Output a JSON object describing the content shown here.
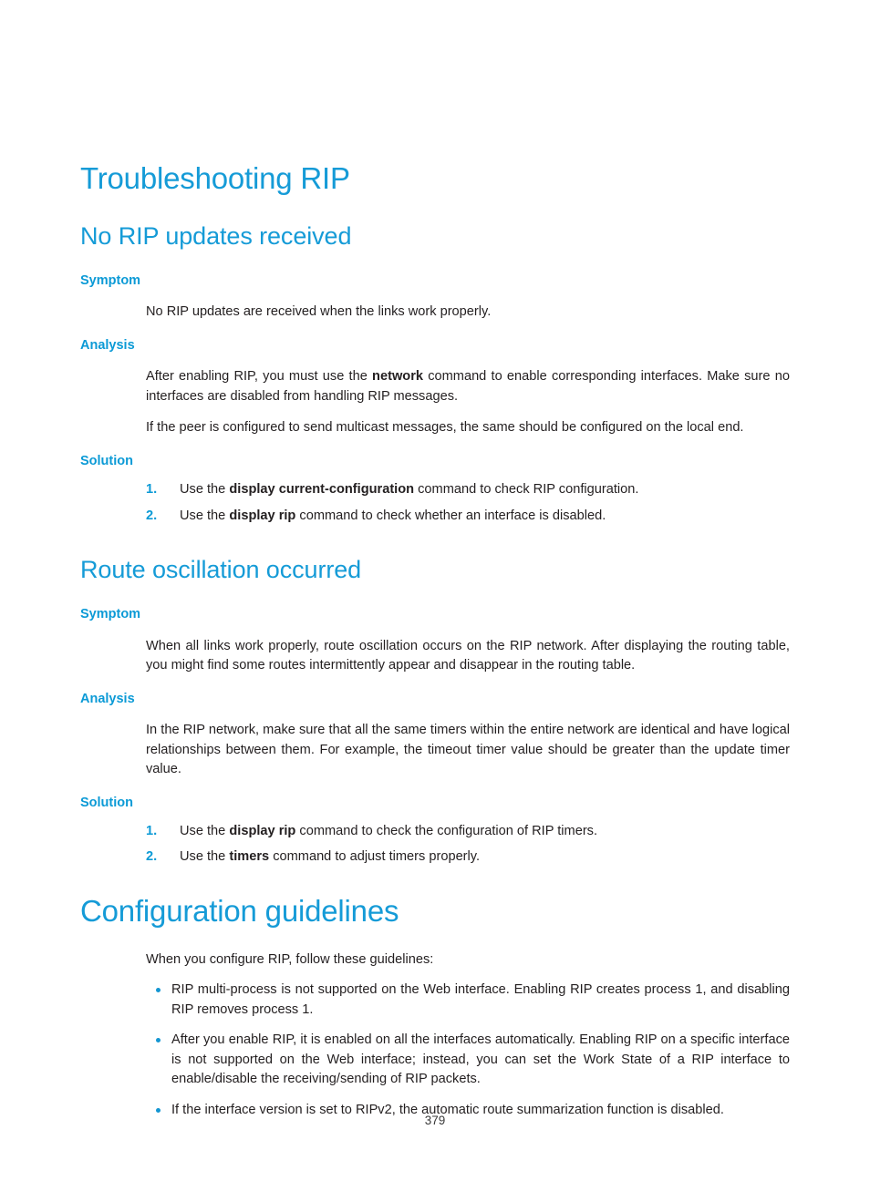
{
  "document": {
    "page_number": "379"
  },
  "colors": {
    "heading": "#159bd7",
    "subheading": "#0b9ad6",
    "list_marker": "#0b9ad6",
    "bullet": "#1496d2",
    "body_text": "#231f20"
  },
  "sections": {
    "troubleshooting": {
      "title": "Troubleshooting RIP",
      "no_rip_updates": {
        "title": "No RIP updates received",
        "symptom_label": "Symptom",
        "symptom_text": "No RIP updates are received when the links work properly.",
        "analysis_label": "Analysis",
        "analysis_p1_a": "After enabling RIP, you must use the ",
        "analysis_p1_b": "network",
        "analysis_p1_c": " command to enable corresponding interfaces. Make sure no interfaces are disabled from handling RIP messages.",
        "analysis_p2": "If the peer is configured to send multicast messages, the same should be configured on the local end.",
        "solution_label": "Solution",
        "solution_steps": [
          {
            "number": "1.",
            "pre": "Use the ",
            "command": "display current-configuration",
            "post": " command to check RIP configuration."
          },
          {
            "number": "2.",
            "pre": "Use the ",
            "command": "display rip",
            "post": " command to check whether an interface is disabled."
          }
        ]
      },
      "route_oscillation": {
        "title": "Route oscillation occurred",
        "symptom_label": "Symptom",
        "symptom_text": "When all links work properly, route oscillation occurs on the RIP network. After displaying the routing table, you might find some routes intermittently appear and disappear in the routing table.",
        "analysis_label": "Analysis",
        "analysis_text": "In the RIP network, make sure that all the same timers within the entire network are identical and have logical relationships between them. For example, the timeout timer value should be greater than the update timer value.",
        "solution_label": "Solution",
        "solution_steps": [
          {
            "number": "1.",
            "pre": "Use the ",
            "command": "display rip",
            "post": " command to check the configuration of RIP timers."
          },
          {
            "number": "2.",
            "pre": "Use the ",
            "command": "timers",
            "post": " command to adjust timers properly."
          }
        ]
      }
    },
    "configuration_guidelines": {
      "title": "Configuration guidelines",
      "intro": "When you configure RIP, follow these guidelines:",
      "bullets": [
        "RIP multi-process is not supported on the Web interface. Enabling RIP creates process 1, and disabling RIP removes process 1.",
        "After you enable RIP, it is enabled on all the interfaces automatically. Enabling RIP on a specific interface is not supported on the Web interface; instead, you can set the Work State of a RIP interface to enable/disable the receiving/sending of RIP packets.",
        "If the interface version is set to RIPv2, the automatic route summarization function is disabled."
      ]
    }
  }
}
